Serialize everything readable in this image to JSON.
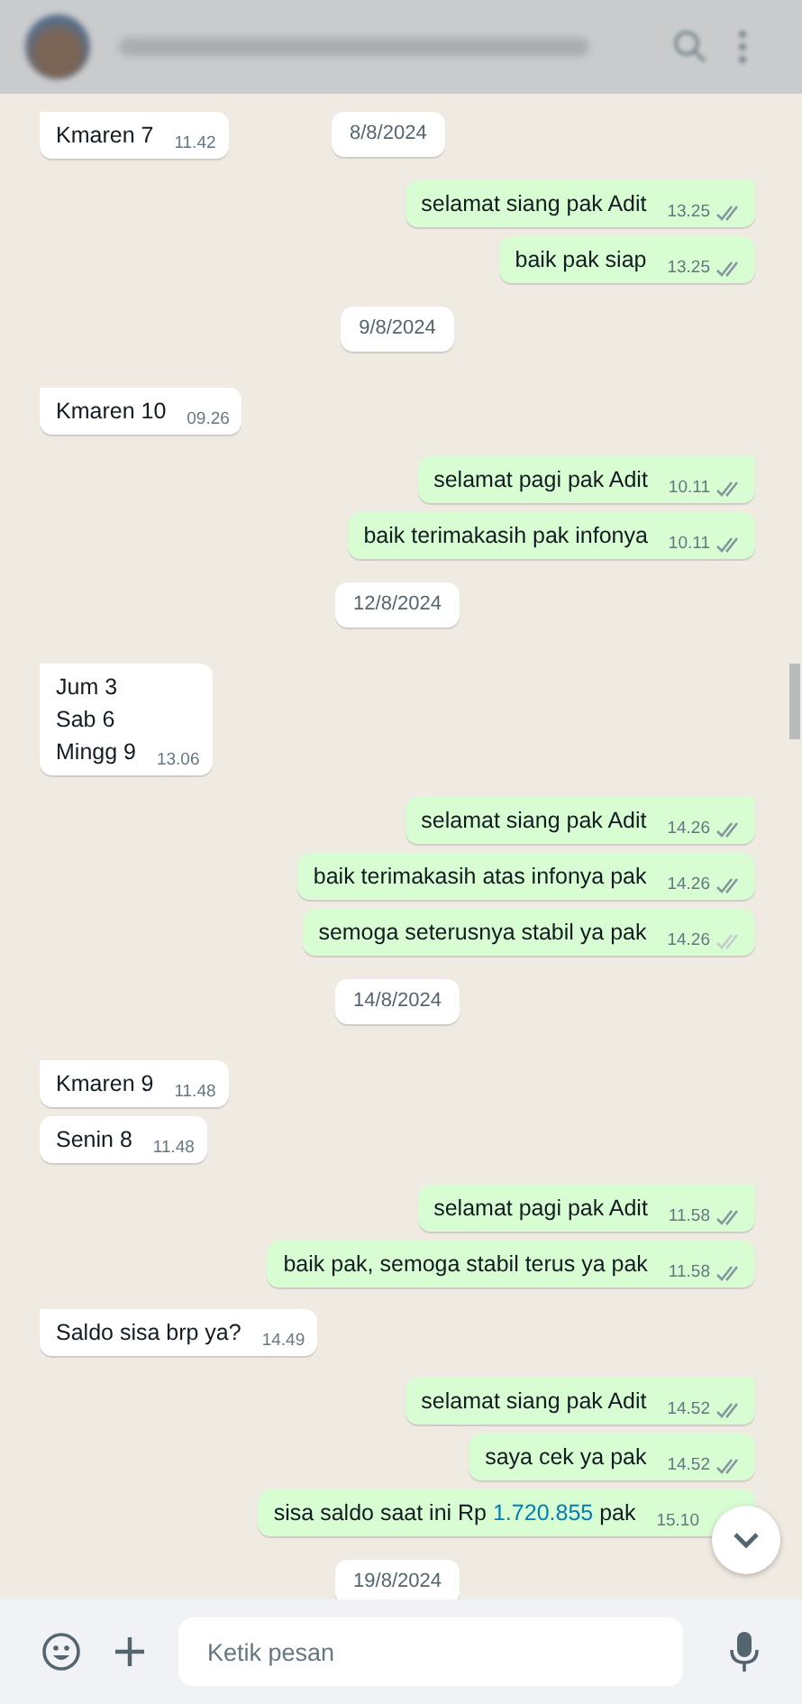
{
  "input_bar": {
    "placeholder": "Ketik pesan"
  },
  "messages": [
    {
      "kind": "in",
      "text": "Kmaren 7",
      "time": "11.42",
      "sticky_date": "8/8/2024"
    },
    {
      "kind": "out",
      "text": "selamat siang pak Adit",
      "time": "13.25",
      "read": true
    },
    {
      "kind": "out",
      "text": "baik pak siap",
      "time": "13.25",
      "read": true
    },
    {
      "kind": "date",
      "text": "9/8/2024"
    },
    {
      "kind": "in",
      "text": "Kmaren 10",
      "time": "09.26"
    },
    {
      "kind": "out",
      "text": "selamat pagi pak Adit",
      "time": "10.11",
      "read": true
    },
    {
      "kind": "out",
      "text": "baik terimakasih pak infonya",
      "time": "10.11",
      "read": true
    },
    {
      "kind": "date",
      "text": "12/8/2024"
    },
    {
      "kind": "in",
      "text": "Jum 3\nSab 6\nMingg 9",
      "time": "13.06"
    },
    {
      "kind": "out",
      "text": "selamat siang pak Adit",
      "time": "14.26",
      "read": true
    },
    {
      "kind": "out",
      "text": "baik terimakasih atas infonya pak",
      "time": "14.26",
      "read": true
    },
    {
      "kind": "out",
      "text": "semoga seterusnya stabil ya pak",
      "time": "14.26",
      "read": false
    },
    {
      "kind": "date",
      "text": "14/8/2024"
    },
    {
      "kind": "in",
      "text": "Kmaren 9",
      "time": "11.48"
    },
    {
      "kind": "in",
      "text": "Senin 8",
      "time": "11.48"
    },
    {
      "kind": "out",
      "text": "selamat pagi pak Adit",
      "time": "11.58",
      "read": true
    },
    {
      "kind": "out",
      "text": "baik pak, semoga stabil terus ya pak",
      "time": "11.58",
      "read": true
    },
    {
      "kind": "in",
      "text": "Saldo sisa brp ya?",
      "time": "14.49"
    },
    {
      "kind": "out",
      "text": "selamat siang pak Adit",
      "time": "14.52",
      "read": true
    },
    {
      "kind": "out",
      "text": "saya cek ya pak",
      "time": "14.52",
      "read": true
    },
    {
      "kind": "out",
      "text": "sisa saldo saat ini Rp ",
      "link": "1.720.855",
      "after": " pak",
      "time": "15.10"
    },
    {
      "kind": "date",
      "text": "19/8/2024"
    }
  ]
}
